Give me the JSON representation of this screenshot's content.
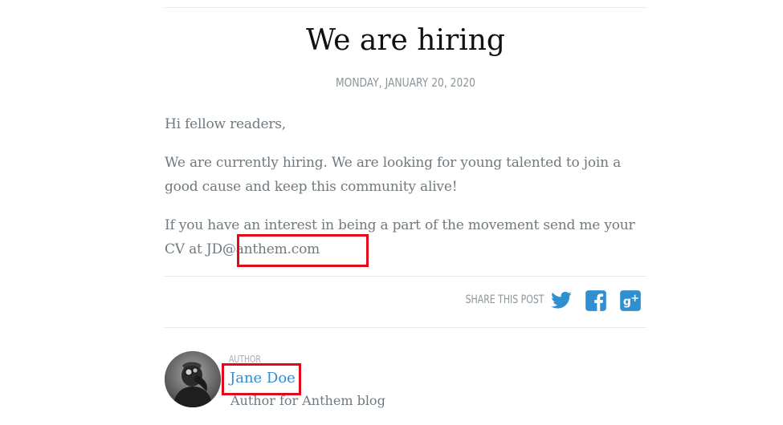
{
  "post": {
    "title": "We are hiring",
    "date": "Monday, January 20, 2020",
    "paragraphs": {
      "greeting": "Hi fellow readers,",
      "p1": "We are currently hiring. We are looking for young talented to join a good cause and keep this community alive!",
      "p2_prefix": "If you have an interest in being a part of the movement send me your CV at ",
      "email": "JD@anthem.com"
    }
  },
  "share": {
    "label": "Share this post",
    "icons": [
      "twitter-icon",
      "facebook-icon",
      "google-plus-icon"
    ]
  },
  "author": {
    "kicker": "Author",
    "name": "Jane Doe",
    "bio": "Author for Anthem blog"
  },
  "colors": {
    "link": "#2f8fd1",
    "text": "#6f7a80",
    "title": "#111111",
    "highlight": "#e3081a"
  }
}
